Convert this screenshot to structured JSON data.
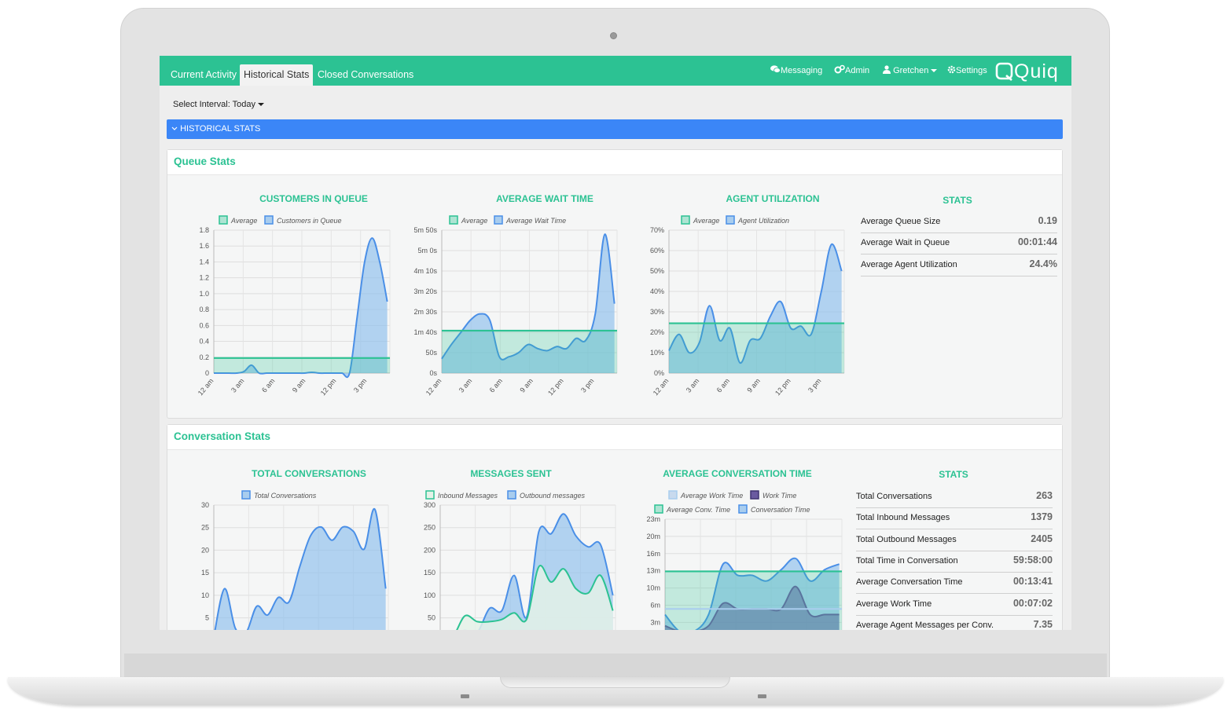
{
  "nav": {
    "tabs": [
      "Current Activity",
      "Historical Stats",
      "Closed Conversations"
    ],
    "active_tab": 1,
    "messaging": "Messaging",
    "admin": "Admin",
    "user": "Gretchen",
    "settings": "Settings",
    "logo_text": "Quiq"
  },
  "interval": {
    "label": "Select Interval: Today"
  },
  "section_bar": {
    "label": "HISTORICAL STATS"
  },
  "colors": {
    "brand": "#2cc293",
    "blue": "#3b86f7",
    "series_blue": "#4a8fe7",
    "fill_blue": "#a9cdee",
    "avg_green": "#2cc293",
    "work_purple": "#6a5aa0"
  },
  "queue_panel": {
    "title": "Queue Stats",
    "stats": {
      "title": "STATS",
      "rows": [
        {
          "label": "Average Queue Size",
          "value": "0.19"
        },
        {
          "label": "Average Wait in Queue",
          "value": "00:01:44"
        },
        {
          "label": "Average Agent Utilization",
          "value": "24.4%"
        }
      ]
    }
  },
  "conversation_panel": {
    "title": "Conversation Stats",
    "stats": {
      "title": "STATS",
      "rows": [
        {
          "label": "Total Conversations",
          "value": "263"
        },
        {
          "label": "Total Inbound Messages",
          "value": "1379"
        },
        {
          "label": "Total Outbound Messages",
          "value": "2405"
        },
        {
          "label": "Total Time in Conversation",
          "value": "59:58:00"
        },
        {
          "label": "Average Conversation Time",
          "value": "00:13:41"
        },
        {
          "label": "Average Work Time",
          "value": "00:07:02"
        },
        {
          "label": "Average Agent Messages per Conv.",
          "value": "7.35"
        }
      ]
    }
  },
  "chart_data": [
    {
      "type": "area",
      "title": "CUSTOMERS IN QUEUE",
      "legend": [
        "Average",
        "Customers in Queue"
      ],
      "x_ticks": [
        "12 am",
        "3 am",
        "6 am",
        "9 am",
        "12 pm",
        "3 pm"
      ],
      "y_ticks": [
        "1.8",
        "1.6",
        "1.4",
        "1.2",
        "1.0",
        "0.8",
        "0.6",
        "0.4",
        "0.2",
        "0"
      ],
      "ylim": [
        0,
        1.8
      ],
      "average": 0.19,
      "series": [
        {
          "name": "Customers in Queue",
          "values": [
            0,
            0,
            0,
            0,
            0.02,
            0.1,
            0,
            0,
            0,
            0,
            0,
            0,
            0,
            0.01,
            0,
            0,
            0,
            0,
            0,
            0.7,
            1.4,
            1.7,
            1.4,
            0.9
          ]
        }
      ]
    },
    {
      "type": "area",
      "title": "AVERAGE WAIT TIME",
      "legend": [
        "Average",
        "Average Wait Time"
      ],
      "x_ticks": [
        "12 am",
        "3 am",
        "6 am",
        "9 am",
        "12 pm",
        "3 pm"
      ],
      "y_ticks": [
        "5m 50s",
        "5m 0s",
        "4m 10s",
        "3m 20s",
        "2m 30s",
        "1m 40s",
        "50s",
        "0s"
      ],
      "ylim": [
        0,
        350
      ],
      "average": 104,
      "series": [
        {
          "name": "Average Wait Time",
          "values": [
            35,
            70,
            100,
            130,
            145,
            130,
            40,
            40,
            50,
            70,
            60,
            55,
            65,
            60,
            85,
            80,
            145,
            340,
            170
          ]
        }
      ]
    },
    {
      "type": "area",
      "title": "AGENT UTILIZATION",
      "legend": [
        "Average",
        "Agent Utilization"
      ],
      "x_ticks": [
        "12 am",
        "3 am",
        "6 am",
        "9 am",
        "12 pm",
        "3 pm"
      ],
      "y_ticks": [
        "70%",
        "60%",
        "50%",
        "40%",
        "30%",
        "20%",
        "10%",
        "0%"
      ],
      "ylim": [
        0,
        70
      ],
      "average": 24.4,
      "series": [
        {
          "name": "Agent Utilization",
          "values": [
            11,
            19,
            10,
            15,
            33,
            16,
            22,
            5,
            16,
            17,
            28,
            35,
            22,
            23,
            19,
            40,
            63,
            50
          ]
        }
      ]
    },
    {
      "type": "area",
      "title": "TOTAL CONVERSATIONS",
      "legend": [
        "Total Conversations"
      ],
      "y_ticks": [
        "30",
        "25",
        "20",
        "15",
        "10",
        "5"
      ],
      "ylim": [
        0,
        30
      ],
      "series": [
        {
          "name": "Total Conversations",
          "values": [
            0,
            11,
            2,
            1,
            7,
            5,
            9,
            8,
            16,
            23,
            25,
            22,
            25,
            24,
            20,
            29,
            11
          ]
        }
      ]
    },
    {
      "type": "area",
      "title": "MESSAGES SENT",
      "legend": [
        "Inbound Messages",
        "Outbound messages"
      ],
      "y_ticks": [
        "300",
        "250",
        "200",
        "150",
        "100",
        "50"
      ],
      "ylim": [
        0,
        300
      ],
      "series": [
        {
          "name": "Outbound messages",
          "values": [
            0,
            5,
            15,
            10,
            65,
            60,
            140,
            45,
            240,
            235,
            280,
            230,
            205,
            210,
            95
          ]
        },
        {
          "name": "Inbound Messages",
          "values": [
            0,
            0,
            48,
            35,
            35,
            40,
            55,
            40,
            160,
            125,
            155,
            110,
            100,
            140,
            60
          ]
        }
      ]
    },
    {
      "type": "area",
      "title": "AVERAGE CONVERSATION TIME",
      "legend": [
        "Average Work Time",
        "Work Time",
        "Average Conv. Time",
        "Conversation Time"
      ],
      "y_ticks": [
        "23m",
        "20m",
        "16m",
        "13m",
        "10m",
        "6m",
        "3m"
      ],
      "ylim": [
        2,
        23
      ],
      "average": 13.7,
      "series": [
        {
          "name": "Conversation Time",
          "values": [
            6,
            3,
            3,
            6,
            15,
            13,
            13,
            12,
            14,
            16,
            12,
            14,
            15
          ]
        },
        {
          "name": "Work Time",
          "values": [
            4,
            3,
            3,
            4,
            8,
            7,
            7,
            7,
            7,
            11,
            6,
            6,
            6
          ]
        }
      ]
    }
  ]
}
